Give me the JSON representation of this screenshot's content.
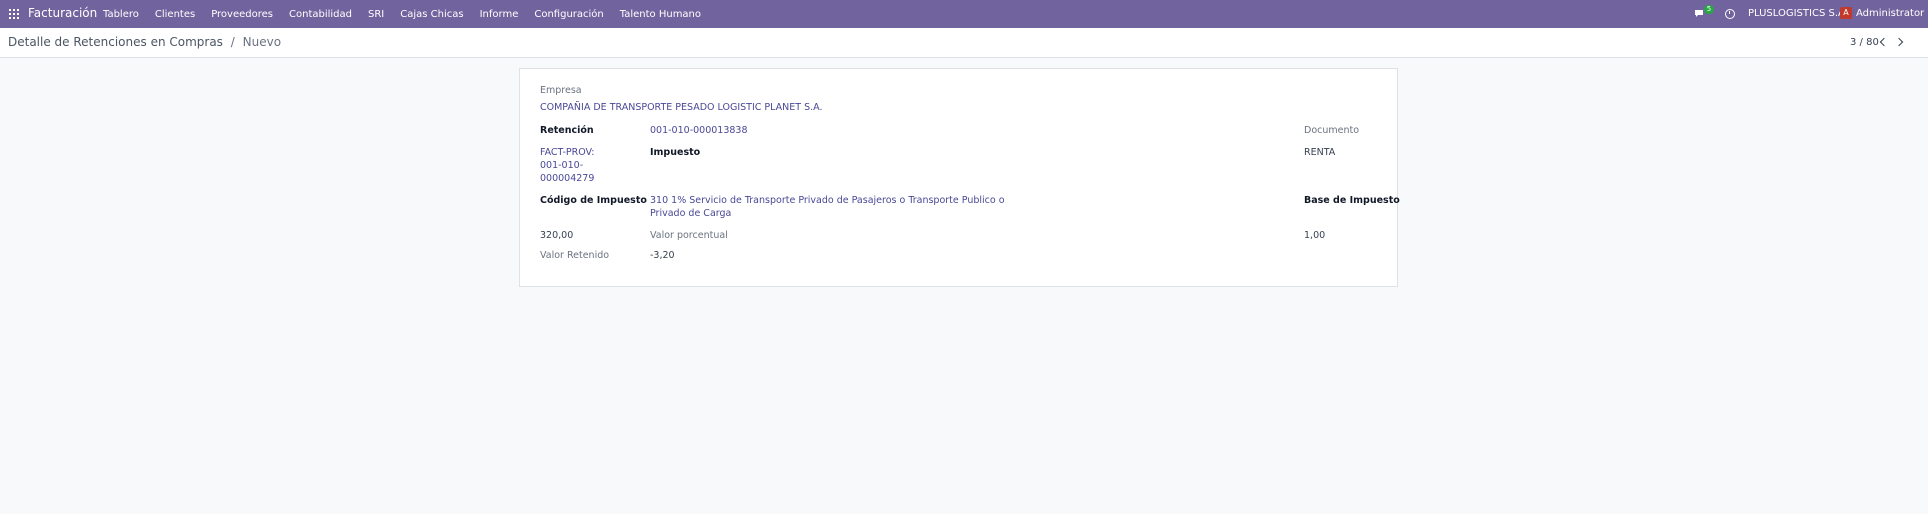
{
  "navbar": {
    "brand": "Facturación",
    "menu": [
      "Tablero",
      "Clientes",
      "Proveedores",
      "Contabilidad",
      "SRI",
      "Cajas Chicas",
      "Informe",
      "Configuración",
      "Talento Humano"
    ],
    "chat_count": "5",
    "company": "PLUSLOGISTICS S.A.",
    "avatar_letter": "A",
    "user": "Administrator",
    "bg_color": "#71639e"
  },
  "breadcrumb": {
    "parent": "Detalle de Retenciones en Compras",
    "separator": "/",
    "current": "Nuevo"
  },
  "pager": {
    "value": "3 / 80"
  },
  "form": {
    "empresa_label": "Empresa",
    "empresa_value": "COMPAÑIA DE TRANSPORTE PESADO LOGISTIC PLANET S.A.",
    "retencion_label": "Retención",
    "retencion_value": "001-010-000013838",
    "documento_label": "Documento",
    "doc_value_line1": "FACT-PROV:",
    "doc_value_line2": "001-010-",
    "doc_value_line3": "000004279",
    "impuesto_label": "Impuesto",
    "impuesto_value": "RENTA",
    "codigo_label": "Código de Impuesto",
    "codigo_value_line1": "310 1% Servicio de Transporte Privado de Pasajeros o Transporte Publico o",
    "codigo_value_line2": "Privado de Carga",
    "base_label": "Base de Impuesto",
    "base_value": "320,00",
    "porcentual_label": "Valor porcentual",
    "porcentual_value": "1,00",
    "retenido_label": "Valor Retenido",
    "retenido_value": "-3,20"
  }
}
